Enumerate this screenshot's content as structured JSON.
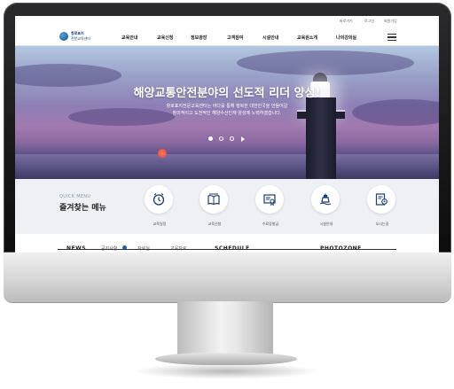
{
  "utility_links": [
    "바로가기",
    "로그인",
    "회원가입"
  ],
  "logo": {
    "line1": "항로표지",
    "line2": "전문교육센터"
  },
  "nav": {
    "items": [
      "교육안내",
      "교육신청",
      "정보광장",
      "고객참여",
      "시설안내",
      "교육원소개",
      "나의강의실"
    ],
    "menu_icon": "hamburger-icon"
  },
  "hero": {
    "title": "해양교통안전분야의 선도적 리더 양성!",
    "subtitle_line1": "항로표지전문교육센터는 바다를 통해 행복한 대한민국을 만들어갈",
    "subtitle_line2": "창의적이고 도전적인 해양수산인재 양성에 노력하겠습니다.",
    "slide_count": 3,
    "active_slide": 1,
    "play_icon": "play-icon"
  },
  "quick_menu": {
    "eyebrow": "QUICK MENU",
    "title": "즐겨찾는 메뉴",
    "items": [
      {
        "label": "교육일정",
        "icon": "clock-icon"
      },
      {
        "label": "교육신청",
        "icon": "open-book-icon"
      },
      {
        "label": "수료증발급",
        "icon": "certificate-icon"
      },
      {
        "label": "시설안내",
        "icon": "buoy-icon"
      },
      {
        "label": "오시는길",
        "icon": "map-pin-icon"
      }
    ]
  },
  "bottom": {
    "news_title": "NEWS",
    "news_tabs": [
      "공지사항",
      "자료실",
      "교육자료"
    ],
    "schedule_title": "SCHEDULE",
    "photo_title": "PHOTOZONE"
  },
  "colors": {
    "brand": "#123e74",
    "quick_bg": "#eef0f5",
    "accent": "#1f5fbf"
  }
}
